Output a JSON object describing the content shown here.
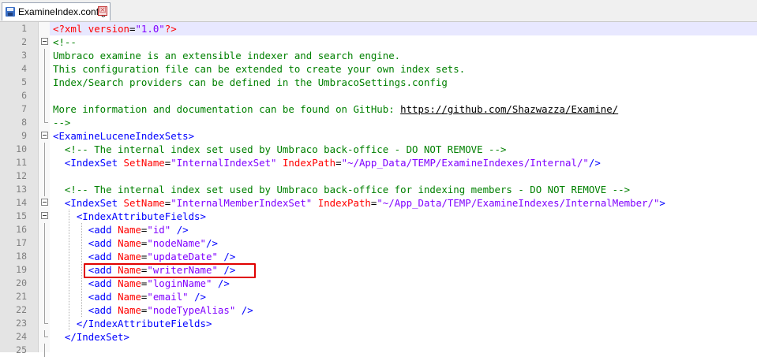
{
  "tab": {
    "label": "ExamineIndex.config",
    "close_glyph": "☒",
    "icon": "save-disk-icon"
  },
  "current_line": 1,
  "highlighted_line": 19,
  "lines": [
    {
      "n": "1",
      "fold": "none",
      "tokens": [
        [
          "decl",
          "<?xml "
        ],
        [
          "attr",
          "version"
        ],
        [
          "txt",
          "="
        ],
        [
          "val",
          "\"1.0\""
        ],
        [
          "decl",
          "?>"
        ]
      ]
    },
    {
      "n": "2",
      "fold": "box",
      "tokens": [
        [
          "comment",
          "<!--"
        ]
      ]
    },
    {
      "n": "3",
      "fold": "vline",
      "tokens": [
        [
          "comment",
          "Umbraco examine is an extensible indexer and search engine."
        ]
      ]
    },
    {
      "n": "4",
      "fold": "vline",
      "tokens": [
        [
          "comment",
          "This configuration file can be extended to create your own index sets."
        ]
      ]
    },
    {
      "n": "5",
      "fold": "vline",
      "tokens": [
        [
          "comment",
          "Index/Search providers can be defined in the UmbracoSettings.config"
        ]
      ]
    },
    {
      "n": "6",
      "fold": "vline",
      "tokens": []
    },
    {
      "n": "7",
      "fold": "vline",
      "tokens": [
        [
          "comment",
          "More information and documentation can be found on GitHub: "
        ],
        [
          "link",
          "https://github.com/Shazwazza/Examine/"
        ]
      ]
    },
    {
      "n": "8",
      "fold": "end",
      "tokens": [
        [
          "comment",
          "-->"
        ]
      ]
    },
    {
      "n": "9",
      "fold": "box",
      "tokens": [
        [
          "tag",
          "<ExamineLuceneIndexSets>"
        ]
      ]
    },
    {
      "n": "10",
      "fold": "vline",
      "tokens": [
        [
          "txt",
          "  "
        ],
        [
          "comment",
          "<!-- The internal index set used by Umbraco back-office - DO NOT REMOVE -->"
        ]
      ]
    },
    {
      "n": "11",
      "fold": "vline",
      "tokens": [
        [
          "txt",
          "  "
        ],
        [
          "tag",
          "<IndexSet "
        ],
        [
          "attr",
          "SetName"
        ],
        [
          "txt",
          "="
        ],
        [
          "val",
          "\"InternalIndexSet\""
        ],
        [
          "txt",
          " "
        ],
        [
          "attr",
          "IndexPath"
        ],
        [
          "txt",
          "="
        ],
        [
          "val",
          "\"~/App_Data/TEMP/ExamineIndexes/Internal/\""
        ],
        [
          "tag",
          "/>"
        ]
      ]
    },
    {
      "n": "12",
      "fold": "vline",
      "tokens": []
    },
    {
      "n": "13",
      "fold": "vline",
      "tokens": [
        [
          "txt",
          "  "
        ],
        [
          "comment",
          "<!-- The internal index set used by Umbraco back-office for indexing members - DO NOT REMOVE -->"
        ]
      ]
    },
    {
      "n": "14",
      "fold": "box",
      "tokens": [
        [
          "txt",
          "  "
        ],
        [
          "tag",
          "<IndexSet "
        ],
        [
          "attr",
          "SetName"
        ],
        [
          "txt",
          "="
        ],
        [
          "val",
          "\"InternalMemberIndexSet\""
        ],
        [
          "txt",
          " "
        ],
        [
          "attr",
          "IndexPath"
        ],
        [
          "txt",
          "="
        ],
        [
          "val",
          "\"~/App_Data/TEMP/ExamineIndexes/InternalMember/\""
        ],
        [
          "tag",
          ">"
        ]
      ]
    },
    {
      "n": "15",
      "fold": "box",
      "tokens": [
        [
          "txt",
          "    "
        ],
        [
          "tag",
          "<IndexAttributeFields>"
        ]
      ]
    },
    {
      "n": "16",
      "fold": "vline",
      "tokens": [
        [
          "txt",
          "      "
        ],
        [
          "tag",
          "<add "
        ],
        [
          "attr",
          "Name"
        ],
        [
          "txt",
          "="
        ],
        [
          "val",
          "\"id\""
        ],
        [
          "txt",
          " "
        ],
        [
          "tag",
          "/>"
        ]
      ]
    },
    {
      "n": "17",
      "fold": "vline",
      "tokens": [
        [
          "txt",
          "      "
        ],
        [
          "tag",
          "<add "
        ],
        [
          "attr",
          "Name"
        ],
        [
          "txt",
          "="
        ],
        [
          "val",
          "\"nodeName\""
        ],
        [
          "tag",
          "/>"
        ]
      ]
    },
    {
      "n": "18",
      "fold": "vline",
      "tokens": [
        [
          "txt",
          "      "
        ],
        [
          "tag",
          "<add "
        ],
        [
          "attr",
          "Name"
        ],
        [
          "txt",
          "="
        ],
        [
          "val",
          "\"updateDate\""
        ],
        [
          "txt",
          " "
        ],
        [
          "tag",
          "/>"
        ]
      ]
    },
    {
      "n": "19",
      "fold": "vline",
      "tokens": [
        [
          "txt",
          "      "
        ],
        [
          "tag",
          "<add "
        ],
        [
          "attr",
          "Name"
        ],
        [
          "txt",
          "="
        ],
        [
          "val",
          "\"writerName\""
        ],
        [
          "txt",
          " "
        ],
        [
          "tag",
          "/>"
        ]
      ]
    },
    {
      "n": "20",
      "fold": "vline",
      "tokens": [
        [
          "txt",
          "      "
        ],
        [
          "tag",
          "<add "
        ],
        [
          "attr",
          "Name"
        ],
        [
          "txt",
          "="
        ],
        [
          "val",
          "\"loginName\""
        ],
        [
          "txt",
          " "
        ],
        [
          "tag",
          "/>"
        ]
      ]
    },
    {
      "n": "21",
      "fold": "vline",
      "tokens": [
        [
          "txt",
          "      "
        ],
        [
          "tag",
          "<add "
        ],
        [
          "attr",
          "Name"
        ],
        [
          "txt",
          "="
        ],
        [
          "val",
          "\"email\""
        ],
        [
          "txt",
          " "
        ],
        [
          "tag",
          "/>"
        ]
      ]
    },
    {
      "n": "22",
      "fold": "vline",
      "tokens": [
        [
          "txt",
          "      "
        ],
        [
          "tag",
          "<add "
        ],
        [
          "attr",
          "Name"
        ],
        [
          "txt",
          "="
        ],
        [
          "val",
          "\"nodeTypeAlias\""
        ],
        [
          "txt",
          " "
        ],
        [
          "tag",
          "/>"
        ]
      ]
    },
    {
      "n": "23",
      "fold": "end",
      "tokens": [
        [
          "txt",
          "    "
        ],
        [
          "tag",
          "</IndexAttributeFields>"
        ]
      ]
    },
    {
      "n": "24",
      "fold": "end",
      "tokens": [
        [
          "txt",
          "  "
        ],
        [
          "tag",
          "</IndexSet>"
        ]
      ]
    },
    {
      "n": "25",
      "fold": "vline",
      "tokens": []
    }
  ]
}
